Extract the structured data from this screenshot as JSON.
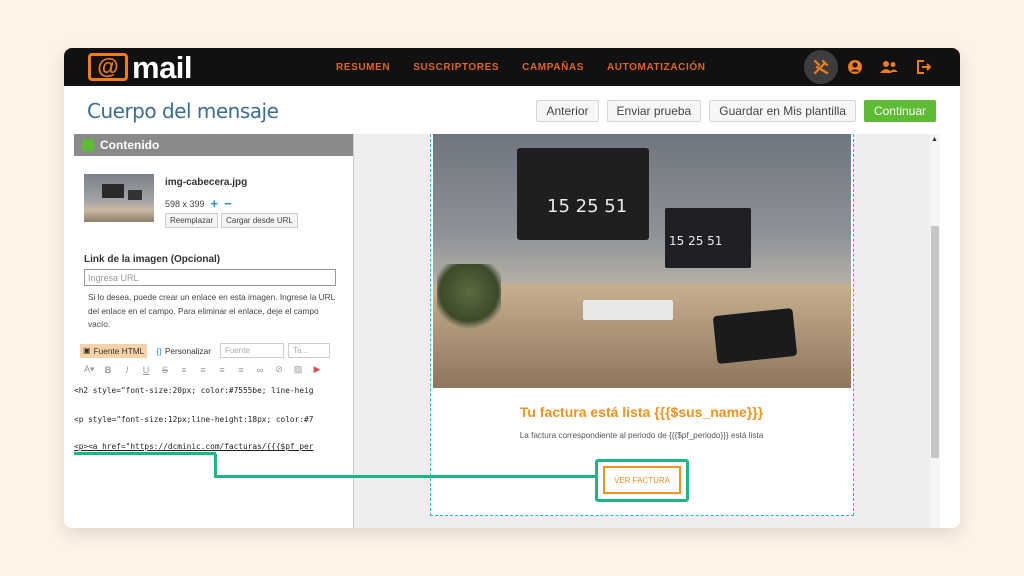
{
  "app": {
    "logo_symbol": "@",
    "logo_text": "mail",
    "accent": "#f07d1a",
    "primary_green": "#5dbb34"
  },
  "nav": {
    "items": [
      "RESUMEN",
      "SUSCRIPTORES",
      "CAMPAÑAS",
      "AUTOMATIZACIÓN"
    ]
  },
  "top_icons": [
    "tools-icon",
    "user-circle-icon",
    "users-icon",
    "logout-icon"
  ],
  "page": {
    "title": "Cuerpo del mensaje"
  },
  "actions": {
    "prev": "Anterior",
    "test": "Enviar prueba",
    "save_template": "Guardar en Mis plantilla",
    "continue": "Continuar"
  },
  "panel": {
    "title": "Contenido",
    "image_name": "img-cabecera.jpg",
    "image_size": "598 x 399",
    "replace": "Reemplazar",
    "load_url": "Cargar desde URL",
    "link_label": "Link de la imagen (Opcional)",
    "link_placeholder": "Ingresa URL",
    "help_text": "Si lo desea, puede crear un enlace en esta imagen. Ingrese la URL del enlace en el campo. Para eliminar el enlace, deje el campo vacío.",
    "tab_html": "Fuente HTML",
    "tab_custom": "Personalizar",
    "font_select": "Fuente",
    "size_select": "Ta...",
    "code_lines": [
      "<h2 style=\"font-size:20px; color:#7555be; line-heig",
      "<p style=\"font-size:12px;line-height:18px; color:#7",
      "<p><a href=\"https://dcminic.com/facturas/{{{$pf_per"
    ]
  },
  "preview": {
    "clock_big": "15 25 51",
    "clock_small": "15 25 51",
    "headline": "Tu factura está lista {{{$sus_name}}}",
    "subline": "La factura correspondiente al periodo de {{{$pf_periodo}}} está lista",
    "cta": "VER FACTURA"
  }
}
